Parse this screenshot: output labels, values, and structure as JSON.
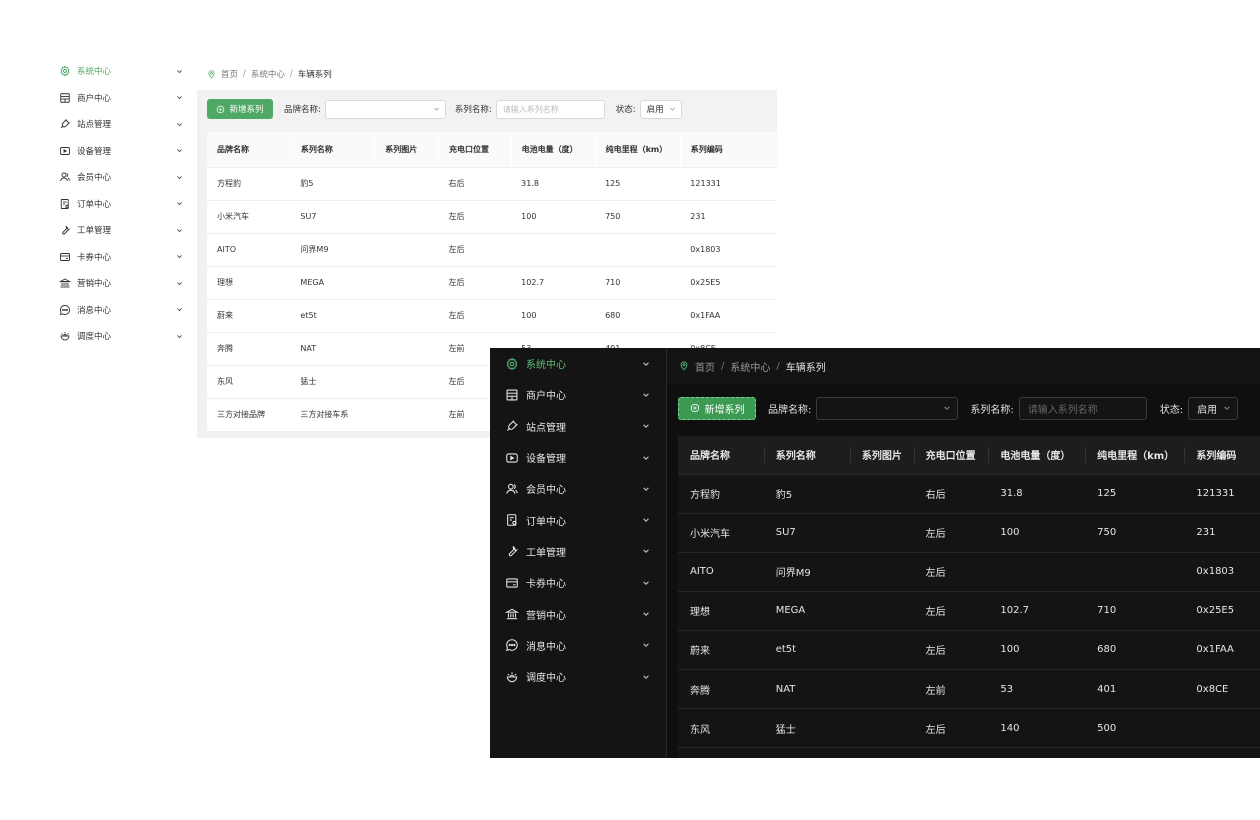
{
  "breadcrumb": [
    "首页",
    "系统中心",
    "车辆系列"
  ],
  "sidebar": {
    "items": [
      {
        "label": "系统中心",
        "icon": "gear-icon",
        "active": true
      },
      {
        "label": "商户中心",
        "icon": "store-icon"
      },
      {
        "label": "站点管理",
        "icon": "plug-icon"
      },
      {
        "label": "设备管理",
        "icon": "video-icon"
      },
      {
        "label": "会员中心",
        "icon": "users-icon"
      },
      {
        "label": "订单中心",
        "icon": "order-icon"
      },
      {
        "label": "工单管理",
        "icon": "wrench-icon"
      },
      {
        "label": "卡券中心",
        "icon": "card-icon"
      },
      {
        "label": "营销中心",
        "icon": "bank-icon"
      },
      {
        "label": "消息中心",
        "icon": "message-icon"
      },
      {
        "label": "调度中心",
        "icon": "dispatch-icon"
      }
    ]
  },
  "toolbar": {
    "add_label": "新增系列",
    "brand_label": "品牌名称:",
    "brand_value": "",
    "series_label": "系列名称:",
    "series_placeholder": "请输入系列名称",
    "status_label": "状态:",
    "status_value": "启用"
  },
  "table": {
    "columns": [
      "品牌名称",
      "系列名称",
      "系列图片",
      "充电口位置",
      "电池电量（度）",
      "纯电里程（km）",
      "系列编码"
    ],
    "rows": [
      [
        "方程豹",
        "豹5",
        "",
        "右后",
        "31.8",
        "125",
        "121331"
      ],
      [
        "小米汽车",
        "SU7",
        "",
        "左后",
        "100",
        "750",
        "231"
      ],
      [
        "AITO",
        "问界M9",
        "",
        "左后",
        "",
        "",
        "0x1803"
      ],
      [
        "理想",
        "MEGA",
        "",
        "左后",
        "102.7",
        "710",
        "0x25E5"
      ],
      [
        "蔚来",
        "et5t",
        "",
        "左后",
        "100",
        "680",
        "0x1FAA"
      ],
      [
        "奔腾",
        "NAT",
        "",
        "左前",
        "53",
        "401",
        "0x8CE"
      ],
      [
        "东风",
        "猛士",
        "",
        "左后",
        "140",
        "500",
        ""
      ],
      [
        "三方对接品牌",
        "三方对接车系",
        "",
        "左前",
        "",
        "",
        ""
      ]
    ]
  },
  "colors": {
    "accent": "#4fa864",
    "accent_dark": "#3d9a52"
  }
}
